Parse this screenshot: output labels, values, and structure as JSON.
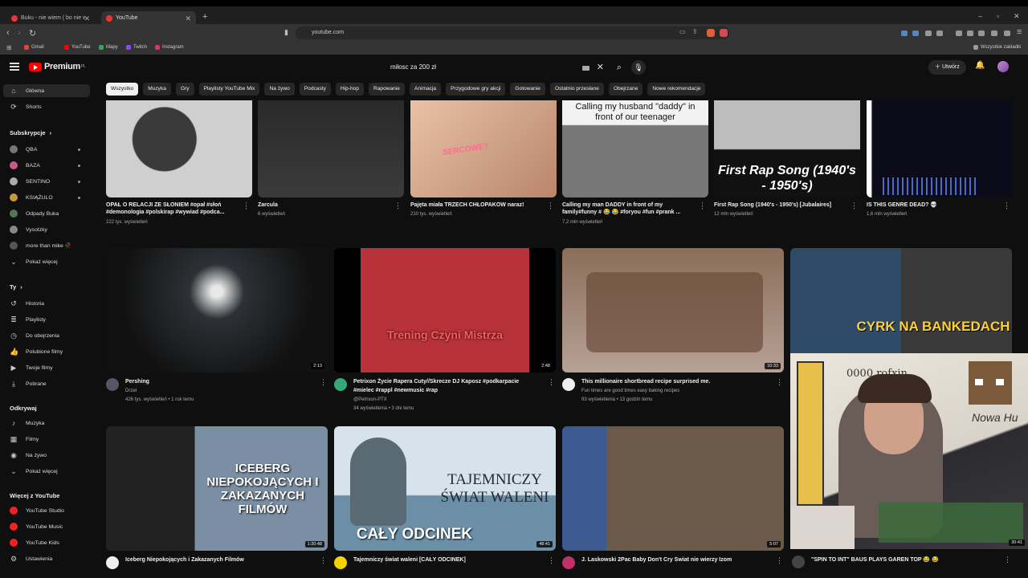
{
  "browser": {
    "tabs": [
      {
        "title": "Buku - nie wiem ( bo nie wiem o czy"
      },
      {
        "title": "YouTube"
      }
    ],
    "url": "youtube.com",
    "bookmarks": [
      {
        "label": "Gmail",
        "color": "#ea4335"
      },
      {
        "label": "YouTube",
        "color": "#ff0000"
      },
      {
        "label": "Mapy",
        "color": "#34a853"
      },
      {
        "label": "Twitch",
        "color": "#9146ff"
      },
      {
        "label": "Instagram",
        "color": "#e1306c"
      }
    ],
    "all_bookmarks": "Wszystkie zakładki"
  },
  "header": {
    "logo": "Premium",
    "region": "PL",
    "search_value": "miłosc za 200 zł",
    "create": "Utwórz"
  },
  "chips": [
    "Wszystko",
    "Muzyka",
    "Gry",
    "Playlisty YouTube Mix",
    "Na żywo",
    "Podcasty",
    "Hip-hop",
    "Rapowanie",
    "Animacja",
    "Przygodowe gry akcji",
    "Gotowanie",
    "Ostatnio przesłane",
    "Obejrzane",
    "Nowe rekomendacje"
  ],
  "sidebar": {
    "main": [
      {
        "label": "Główna",
        "icon": "home-icon"
      },
      {
        "label": "Shorts",
        "icon": "shorts-icon"
      }
    ],
    "subs_header": "Subskrypcje",
    "subs": [
      {
        "label": "QBA",
        "color": "#777"
      },
      {
        "label": "BAZA",
        "color": "#c45b8a"
      },
      {
        "label": "SENTINO",
        "color": "#aaa"
      },
      {
        "label": "KSIĄŻULO",
        "color": "#c59a3a"
      },
      {
        "label": "Odpady Buka",
        "color": "#557755"
      },
      {
        "label": "Vysotzky",
        "color": "#888"
      },
      {
        "label": "more than mike 🥀",
        "color": "#555"
      },
      {
        "label": "Pokaż więcej",
        "color": ""
      }
    ],
    "you_header": "Ty",
    "you": [
      {
        "label": "Historia",
        "icon": "history-icon"
      },
      {
        "label": "Playlisty",
        "icon": "playlist-icon"
      },
      {
        "label": "Do obejrzenia",
        "icon": "clock-icon"
      },
      {
        "label": "Polubione filmy",
        "icon": "thumbs-up-icon"
      },
      {
        "label": "Twoje filmy",
        "icon": "video-icon"
      },
      {
        "label": "Pobrane",
        "icon": "download-icon"
      }
    ],
    "explore_header": "Odkrywaj",
    "explore": [
      {
        "label": "Muzyka",
        "icon": "music-icon"
      },
      {
        "label": "Filmy",
        "icon": "film-icon"
      },
      {
        "label": "Na żywo",
        "icon": "live-icon"
      },
      {
        "label": "Pokaż więcej",
        "icon": "chevron-down-icon"
      }
    ],
    "more_header": "Więcej z YouTube",
    "more": [
      {
        "label": "YouTube Studio"
      },
      {
        "label": "YouTube Music"
      },
      {
        "label": "YouTube Kids"
      },
      {
        "label": "Ustawienia"
      }
    ]
  },
  "shorts": [
    {
      "title": "OPAŁ O RELACJI ZE SŁONIEM #opał #słoń #demonologia #polskirap #wywiad #podca...",
      "views": "222 tys. wyświetleń"
    },
    {
      "title": "Zarcula",
      "views": "6 wyświetleń"
    },
    {
      "title": "Pajęta miała TRZECH CHŁOPAKÓW naraz!",
      "views": "210 tys. wyświetleń",
      "overlay": "SERCOWE?"
    },
    {
      "title": "Calling my man DADDY in front of my family#funny # 😂 😂 #foryou #fun #prank ...",
      "views": "7,2 mln wyświetleń",
      "overlay": "Calling my husband \"daddy\" in front of our teenager"
    },
    {
      "title": "First Rap Song (1940's - 1950's) [Jubalaires]",
      "views": "12 mln wyświetleń",
      "overlay": "First Rap Song (1940's - 1950's)"
    },
    {
      "title": "IS THIS GENRE DEAD? 💀",
      "views": "1,6 mln wyświetleń"
    }
  ],
  "videos_row1": [
    {
      "title": "Pershing",
      "channel": "Drzeł",
      "meta": "426 tys. wyświetleń • 1 rok temu",
      "duration": "2:13",
      "title2": ""
    },
    {
      "title": "Petrixon Życie Rapera Cuty//Skrecze DJ Kaposz #podkarpacie",
      "title2": "#mielec #rappl #newmusic #rap",
      "channel": "@Petrixon-PTX",
      "meta": "34 wyświetlenia • 3 dni temu",
      "duration": "2:48",
      "overlay": "Trening Czyni Mistrza"
    },
    {
      "title": "This millionaire shortbread recipe surprised me.",
      "channel": "Fun times are good times easy baking recipes",
      "meta": "93 wyświetlenia • 13 godzin temu",
      "duration": "10:33",
      "title2": ""
    },
    {
      "title": "",
      "channel": "",
      "meta": "",
      "duration": "",
      "overlay": "CYRK NA BANKEDACH"
    }
  ],
  "videos_row2": [
    {
      "title": "Iceberg Niepokojących i Zakazanych Filmów",
      "duration": "1:20:48",
      "overlay": "ICEBERG NIEPOKOJĄCYCH I ZAKAZANYCH FILMÓW"
    },
    {
      "title": "Tajemniczy świat waleni [CAŁY ODCINEK]",
      "duration": "48:41",
      "overlay": "TAJEMNICZY ŚWIAT WALENI",
      "overlay2": "CAŁY ODCINEK"
    },
    {
      "title": "J. Laskowski  2Pac Baby Don't Cry Świat nie wierzy Izom",
      "duration": "5:07"
    },
    {
      "title": "\"SPIN TO INT\" BAUS PLAYS GAREN TOP 😂 😂",
      "duration": "30:41"
    }
  ],
  "webcam": {
    "handwriting": "0000 rofxin",
    "minecraft_text": "Nowa Hu"
  }
}
